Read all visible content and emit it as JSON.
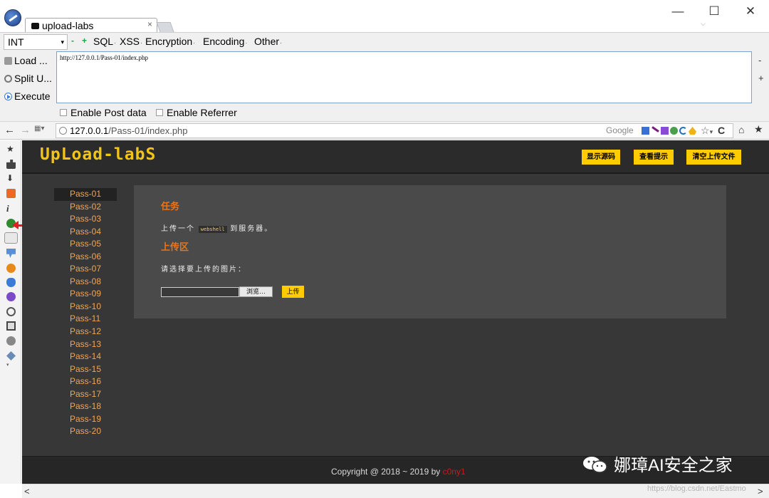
{
  "window": {
    "tab_title": "upload-labs",
    "tab_close": "×",
    "minimize": "—",
    "maximize": "☐",
    "close": "✕",
    "chevron": "⌵"
  },
  "hackbar": {
    "select_value": "INT",
    "select_arrow": "▾",
    "minus": "-",
    "plus": "+",
    "menus": [
      "SQL",
      "XSS",
      "Encoding",
      "Other"
    ],
    "menu_encryption": "Encryption",
    "menu_dot": "·",
    "load_label": "Load ...",
    "split_label": "Split U...",
    "execute_label": "Execute",
    "url_value": "http://127.0.0.1/Pass-01/index.php",
    "side_minus": "-",
    "side_plus": "+",
    "enable_post": "Enable Post data",
    "enable_referrer": "Enable Referrer"
  },
  "navbar": {
    "back": "←",
    "forward": "→",
    "url_host": "127.0.0.1",
    "url_path": "/Pass-01/index.php",
    "search_engine": "Google",
    "bookmark": "☆",
    "bookmark_arrow": "▾",
    "refresh": "C",
    "home": "⌂",
    "favorites": "★"
  },
  "page": {
    "logo": "UpLoad-labS",
    "header_buttons": [
      "显示源码",
      "查看提示",
      "清空上传文件"
    ],
    "menu": [
      "Pass-01",
      "Pass-02",
      "Pass-03",
      "Pass-04",
      "Pass-05",
      "Pass-06",
      "Pass-07",
      "Pass-08",
      "Pass-09",
      "Pass-10",
      "Pass-11",
      "Pass-12",
      "Pass-13",
      "Pass-14",
      "Pass-15",
      "Pass-16",
      "Pass-17",
      "Pass-18",
      "Pass-19",
      "Pass-20"
    ],
    "task_heading": "任务",
    "task_prefix": "上传一个",
    "task_code": "webshell",
    "task_suffix": "到服务器。",
    "upload_heading": "上传区",
    "select_prompt": "请选择要上传的图片：",
    "browse_label": "浏览…",
    "upload_label": "上传",
    "copyright_prefix": "Copyright @ 2018 ~ 2019 by ",
    "copyright_author": "c0ny1"
  },
  "watermark": {
    "text": "娜璋AI安全之家",
    "csdn": "https://blog.csdn.net/Eastmo"
  },
  "scroll": {
    "left": "<",
    "right": ">"
  },
  "colors": {
    "accent_yellow": "#ffcc00",
    "menu_orange": "#f0a65a",
    "heading_orange": "#e9741c",
    "page_bg": "#373737",
    "author_red": "#c81a1a"
  }
}
